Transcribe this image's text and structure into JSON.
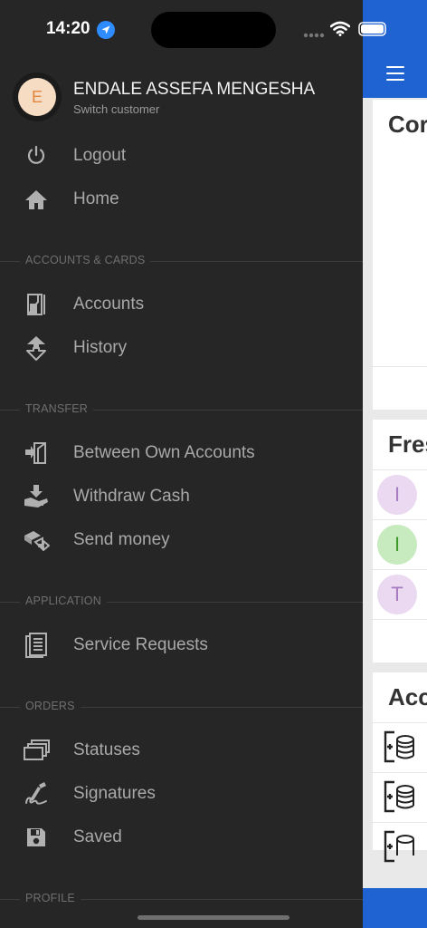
{
  "status_bar": {
    "time": "14:20"
  },
  "profile": {
    "initial": "E",
    "name": "ENDALE ASSEFA MENGESHA",
    "subtitle": "Switch customer"
  },
  "menu": {
    "logout": "Logout",
    "home": "Home",
    "accounts_section": "ACCOUNTS & CARDS",
    "accounts": "Accounts",
    "history": "History",
    "transfer_section": "TRANSFER",
    "between_own": "Between Own Accounts",
    "withdraw_cash": "Withdraw Cash",
    "send_money": "Send money",
    "application_section": "APPLICATION",
    "service_requests": "Service Requests",
    "orders_section": "ORDERS",
    "statuses": "Statuses",
    "signatures": "Signatures",
    "saved": "Saved",
    "profile_section": "PROFILE"
  },
  "background": {
    "card1_title": "Cor",
    "card2_title": "Fres",
    "card3_title": "Acc",
    "contacts": [
      {
        "initial": "I",
        "bg": "#ead9f0",
        "fg": "#a77cc0"
      },
      {
        "initial": "I",
        "bg": "#c7eabf",
        "fg": "#3f9a2c"
      },
      {
        "initial": "T",
        "bg": "#ead9f0",
        "fg": "#a77cc0"
      }
    ]
  },
  "colors": {
    "drawer_bg": "#262626",
    "brand_blue": "#1f63d2",
    "avatar_bg": "#f6dcc3",
    "avatar_fg": "#e3873f"
  }
}
